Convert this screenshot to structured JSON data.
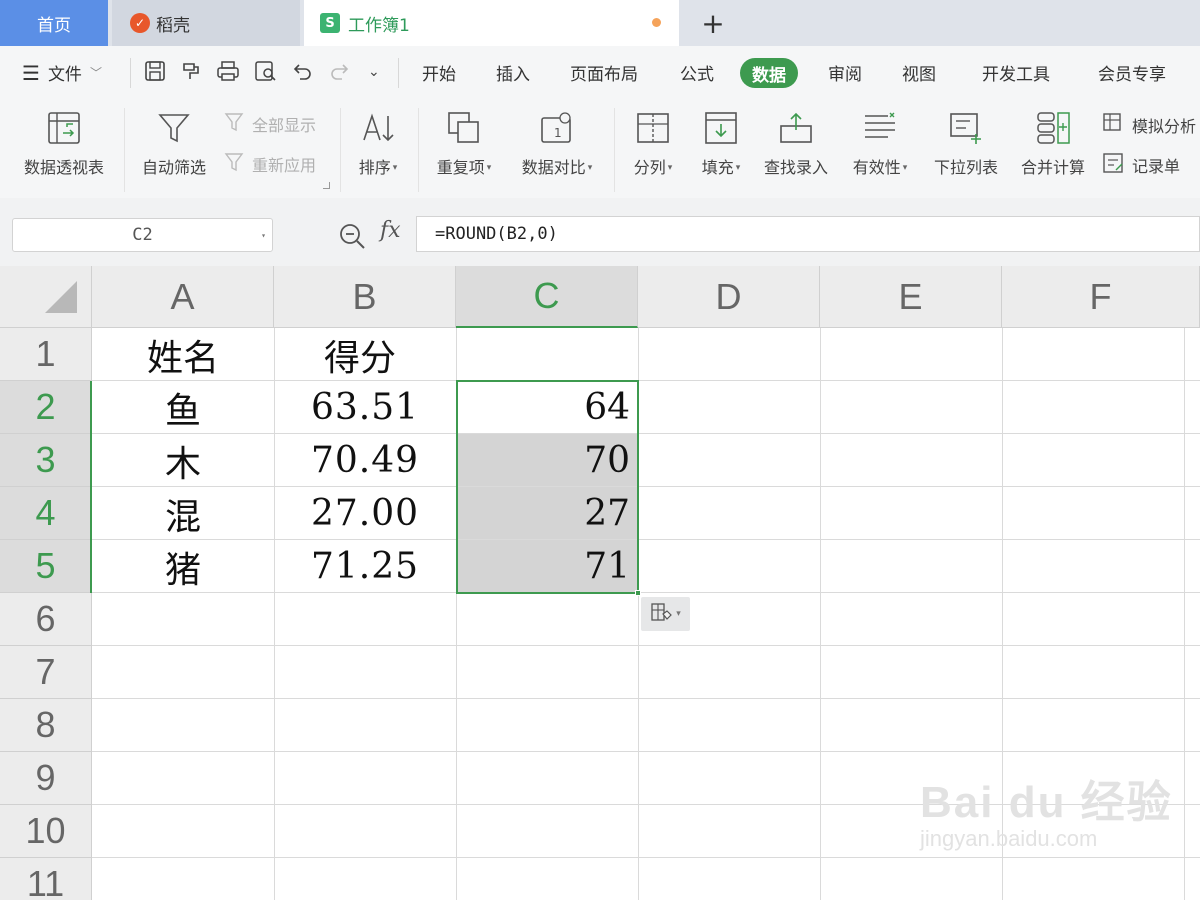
{
  "tabs": {
    "home": "首页",
    "daoke": "稻壳",
    "workbook": "工作簿1",
    "new_tab": "+"
  },
  "menu": {
    "file": "文件",
    "tabs": [
      "开始",
      "插入",
      "页面布局",
      "公式",
      "数据",
      "审阅",
      "视图",
      "开发工具",
      "会员专享"
    ],
    "active_tab": "数据"
  },
  "ribbon": {
    "pivot": "数据透视表",
    "autofilter": "自动筛选",
    "show_all": "全部显示",
    "reapply": "重新应用",
    "sort": "排序",
    "duplicates": "重复项",
    "compare": "数据对比",
    "split": "分列",
    "fill": "填充",
    "find_entry": "查找录入",
    "validity": "有效性",
    "dropdown_list": "下拉列表",
    "consolidate": "合并计算",
    "simulate": "模拟分析",
    "record": "记录单"
  },
  "formula_bar": {
    "cell_ref": "C2",
    "fx": "fx",
    "formula": "=ROUND(B2,0)"
  },
  "sheet": {
    "columns": [
      "A",
      "B",
      "C",
      "D",
      "E",
      "F"
    ],
    "rows": [
      "1",
      "2",
      "3",
      "4",
      "5",
      "6",
      "7",
      "8",
      "9",
      "10",
      "11"
    ],
    "selected_column": "C",
    "selected_rows": [
      "2",
      "3",
      "4",
      "5"
    ],
    "header": {
      "name": "姓名",
      "score": "得分"
    },
    "data": [
      {
        "name": "鱼",
        "score": "63.51",
        "rounded": "64"
      },
      {
        "name": "木",
        "score": "70.49",
        "rounded": "70"
      },
      {
        "name": "混",
        "score": "27.00",
        "rounded": "27"
      },
      {
        "name": "猪",
        "score": "71.25",
        "rounded": "71"
      }
    ]
  },
  "watermark": {
    "brand": "Bai du 经验",
    "url": "jingyan.baidu.com"
  },
  "colors": {
    "accent_green": "#3d9a4f",
    "home_tab_blue": "#5b8fe6",
    "selection_fill": "#d4d4d4"
  }
}
